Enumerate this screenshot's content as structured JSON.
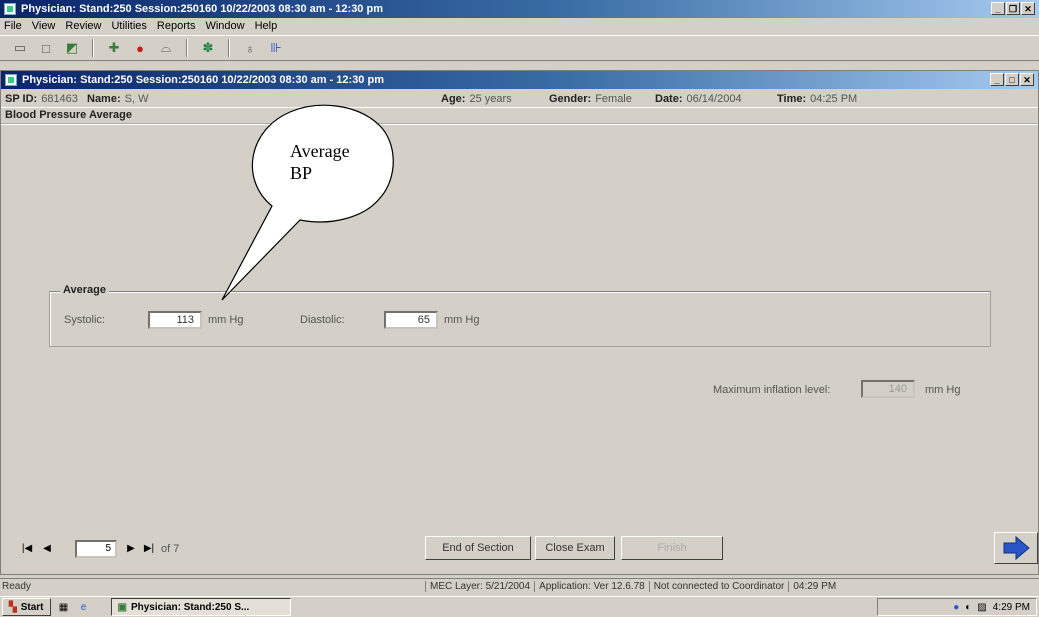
{
  "app": {
    "title": "Physician: Stand:250 Session:250160 10/22/2003 08:30 am - 12:30 pm"
  },
  "menu": [
    "File",
    "View",
    "Review",
    "Utilities",
    "Reports",
    "Window",
    "Help"
  ],
  "toolbar_icons": [
    "door-icon",
    "blank-page-icon",
    "folder-icon",
    "tools-icon",
    "tomato-icon",
    "cup-icon",
    "palette-icon",
    "stethoscope-icon",
    "exit-icon"
  ],
  "inner_window": {
    "title": "Physician: Stand:250 Session:250160 10/22/2003 08:30 am - 12:30 pm"
  },
  "patient": {
    "sp_id_label": "SP ID:",
    "sp_id": "681463",
    "name_label": "Name:",
    "name": "S, W",
    "age_label": "Age:",
    "age": "25 years",
    "gender_label": "Gender:",
    "gender": "Female",
    "date_label": "Date:",
    "date": "06/14/2004",
    "time_label": "Time:",
    "time": "04:25 PM"
  },
  "section_title": "Blood Pressure Average",
  "average_group": {
    "legend": "Average",
    "systolic_label": "Systolic:",
    "systolic_value": "113",
    "systolic_unit": "mm Hg",
    "diastolic_label": "Diastolic:",
    "diastolic_value": "65",
    "diastolic_unit": "mm Hg"
  },
  "max_inflation": {
    "label": "Maximum inflation level:",
    "value": "140",
    "unit": "mm Hg"
  },
  "pager": {
    "current": "5",
    "of_text": "of 7"
  },
  "buttons": {
    "end_section": "End of Section",
    "close_exam": "Close Exam",
    "finish": "Finish"
  },
  "status": {
    "ready": "Ready",
    "mec_layer": "MEC Layer: 5/21/2004",
    "application": "Application: Ver 12.6.78",
    "coordinator": "Not connected to Coordinator",
    "time": "04:29 PM"
  },
  "taskbar": {
    "start": "Start",
    "task": "Physician: Stand:250 S...",
    "clock": "4:29 PM"
  },
  "callout": {
    "line1": "Average",
    "line2": "BP"
  },
  "colors": {
    "title_active": "#0a246a",
    "title_fade": "#a6caf0",
    "window_bg": "#d4d0c8",
    "arrow_blue": "#2a54c8"
  }
}
